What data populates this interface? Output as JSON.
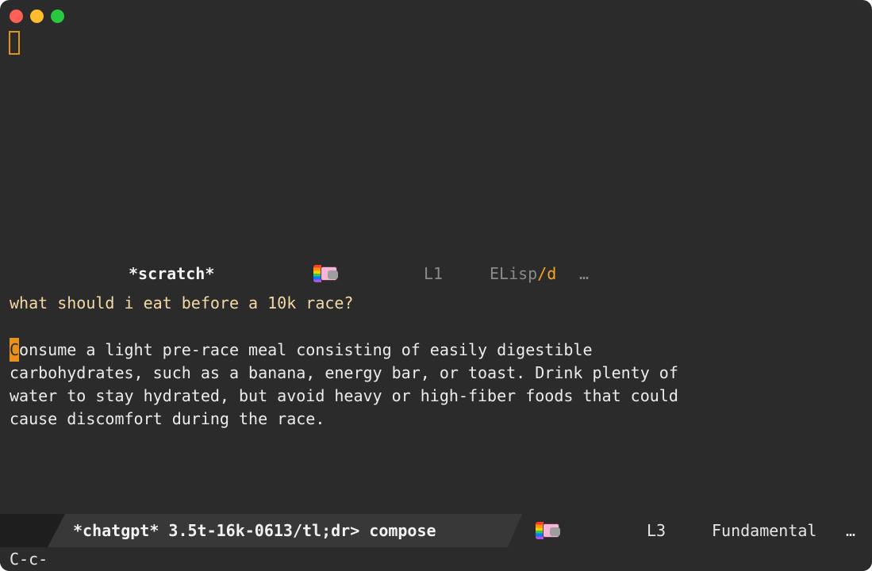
{
  "window": {
    "buttons": [
      "close",
      "minimize",
      "zoom"
    ]
  },
  "scratch_modeline": {
    "buffer_name": "*scratch*",
    "line": "L1",
    "mode_main": "ELisp",
    "mode_sep": "/",
    "mode_suffix": "d",
    "ellipsis": "…"
  },
  "chat": {
    "prompt": "what should i eat before a 10k race?",
    "answer_first_char": "C",
    "answer_line1_rest": "onsume a light pre-race meal consisting of easily digestible",
    "answer_line2": "carbohydrates, such as a banana, energy bar, or toast. Drink plenty of",
    "answer_line3": "water to stay hydrated, but avoid heavy or high-fiber foods that could",
    "answer_line4": "cause discomfort during the race."
  },
  "chatgpt_modeline": {
    "buffer_info": "*chatgpt* 3.5t-16k-0613/tl;dr> compose",
    "line": "L3",
    "mode": "Fundamental",
    "ellipsis": "…"
  },
  "echo_area": {
    "text": "C-c-"
  },
  "colors": {
    "background": "#2b2b2b",
    "cursor": "#e8911c",
    "prompt_text": "#f3d9a6",
    "accent": "#f5a623"
  },
  "icons": [
    "nyan-cat-icon",
    "nyan-cat-icon"
  ]
}
